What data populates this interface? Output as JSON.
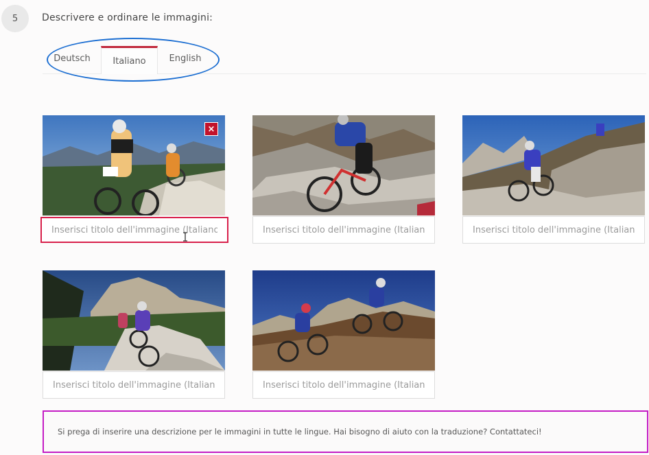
{
  "step": {
    "number": "5",
    "title": "Descrivere e ordinare le immagini:"
  },
  "tabs": [
    {
      "label": "Deutsch",
      "active": false
    },
    {
      "label": "Italiano",
      "active": true
    },
    {
      "label": "English",
      "active": false
    }
  ],
  "images": [
    {
      "caption_placeholder": "Inserisci titolo dell'immagine (Italiano)",
      "caption_value": ""
    },
    {
      "caption_placeholder": "Inserisci titolo dell'immagine (Italiano)",
      "caption_value": ""
    },
    {
      "caption_placeholder": "Inserisci titolo dell'immagine (Italiano)",
      "caption_value": ""
    },
    {
      "caption_placeholder": "Inserisci titolo dell'immagine (Italiano)",
      "caption_value": ""
    },
    {
      "caption_placeholder": "Inserisci titolo dell'immagine (Italiano)",
      "caption_value": ""
    }
  ],
  "delete_button": {
    "label": "×"
  },
  "notice": {
    "text": "Si prega di inserire una descrizione per le immagini in tutte le lingue. Hai bisogno di aiuto con la traduzione? Contattateci!"
  },
  "colors": {
    "active_tab_accent": "#c0263a",
    "tab_highlight_ellipse": "#1d6fd2",
    "active_input_border": "#d81f4a",
    "notice_border": "#c41cc4",
    "delete_button_bg": "#c2132c"
  }
}
